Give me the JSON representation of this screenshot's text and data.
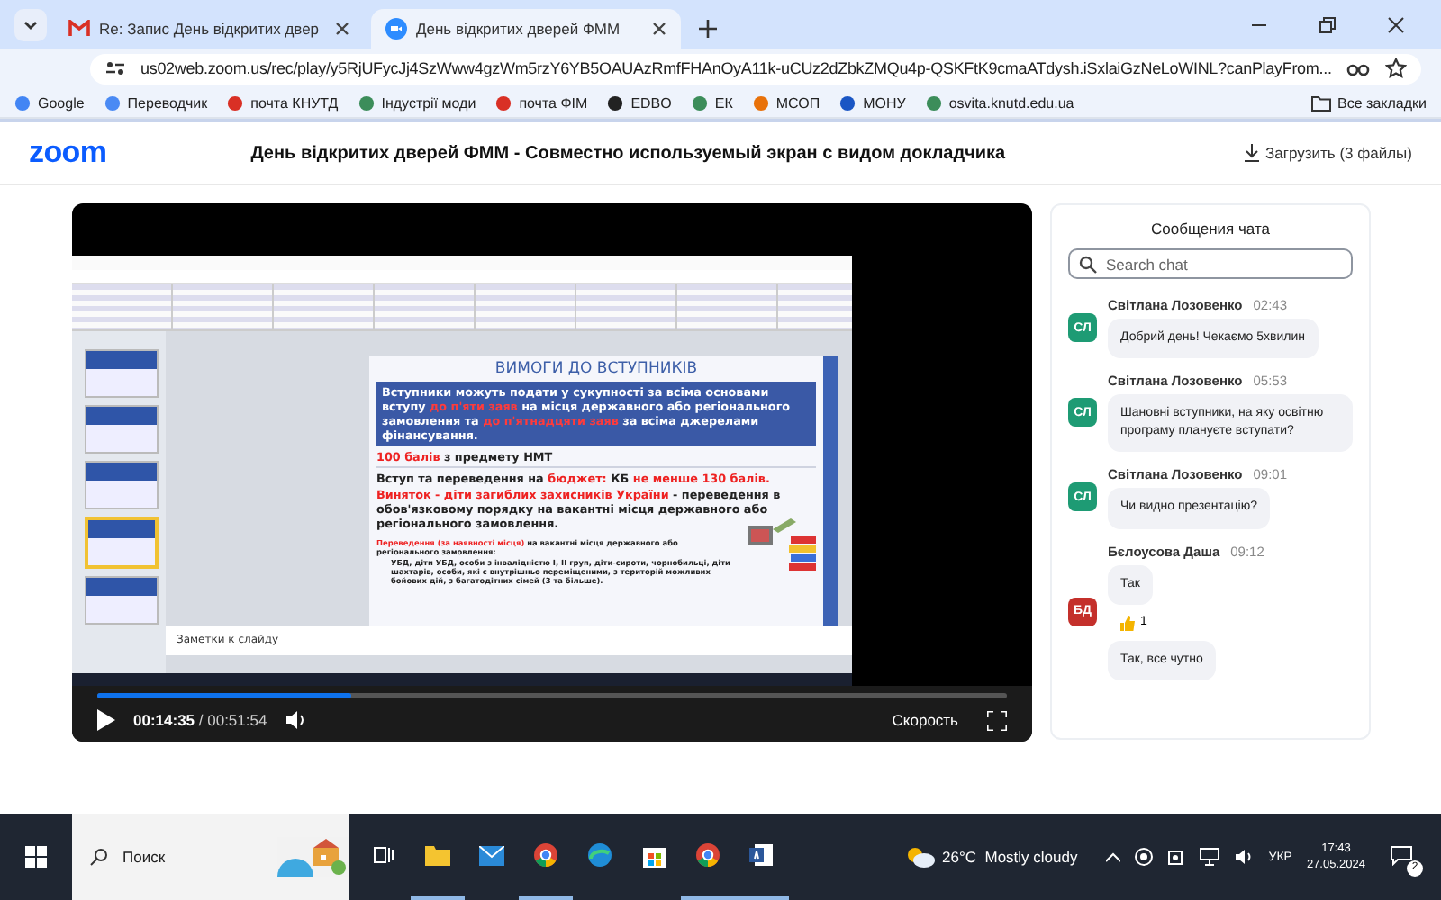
{
  "browser": {
    "tabs": [
      {
        "title": "Re: Запис День відкритих двер",
        "selected": false
      },
      {
        "title": "День відкритих дверей ФММ",
        "selected": true
      }
    ],
    "url": "us02web.zoom.us/rec/play/y5RjUFycJj4SzWww4gzWm5rzY6YB5OAUAzRmfFHAnOyA11k-uCUz2dZbkZMQu4p-QSKFtK9cmaATdysh.iSxlaiGzNeLoWINL?canPlayFrom...",
    "bookmarks": [
      {
        "label": "Google"
      },
      {
        "label": "Переводчик"
      },
      {
        "label": "почта КНУТД"
      },
      {
        "label": "Індустрії моди"
      },
      {
        "label": "почта ФІМ"
      },
      {
        "label": "EDBO"
      },
      {
        "label": "ЕК"
      },
      {
        "label": "МСОП"
      },
      {
        "label": "МОНУ"
      },
      {
        "label": "osvita.knutd.edu.ua"
      }
    ],
    "all_bookmarks": "Все закладки"
  },
  "header": {
    "logo": "zoom",
    "title": "День відкритих дверей ФММ - Совместно используемый экран с видом докладчика",
    "download": "Загрузить (3 файлы)"
  },
  "video": {
    "slide": {
      "title": "ВИМОГИ ДО ВСТУПНИКІВ",
      "lead": "Вступники можуть подати у сукупності за всіма основами вступу **до п'яти заяв** на місця державного або регіонального замовлення та **до п'ятнадцяти заяв** за всіма джерелами фінансування.",
      "score": "**100 балів** з предмету НМТ",
      "admission": "Вступ та переведення на **бюджет:** КБ **не менше 130 балів. Виняток - діти загиблих захисників України** - переведення в обов'язковому порядку на вакантні місця державного або регіонального замовлення.",
      "transfer": "**Переведення (за наявності місця)** на вакантні місця державного або регіонального замовлення:",
      "bullet": "УБД, діти УБД, особи з інвалідністю I, II груп, діти-сироти, чорнобильці, діти шахтарів, особи, які є внутрішньо переміщеними, з територій можливих бойових дій, з багатодітних сімей (3 та більше)."
    },
    "notes": "Заметки к слайду",
    "player": {
      "time": "**00:14:35** / 00:51:54",
      "level": 0.28,
      "speed": "Скорость"
    }
  },
  "chat": {
    "title": "Сообщения чата",
    "search": {
      "placeholder": "Search chat"
    },
    "messages": [
      {
        "author": "Світлана Лозовенко",
        "time": "02:43",
        "initials": "СЛ",
        "color": "#1e9b74",
        "bubbles": [
          {
            "text": "Добрий день! Чекаємо 5хвилин"
          }
        ]
      },
      {
        "author": "Світлана Лозовенко",
        "time": "05:53",
        "initials": "СЛ",
        "color": "#1e9b74",
        "bubbles": [
          {
            "text": "Шановні вступники, на яку освітню програму плануєте вступати?"
          }
        ]
      },
      {
        "author": "Світлана Лозовенко",
        "time": "09:01",
        "initials": "СЛ",
        "color": "#1e9b74",
        "bubbles": [
          {
            "text": "Чи видно презентацію?"
          }
        ]
      },
      {
        "author": "Бєлоусова Даша",
        "time": "09:12",
        "initials": "БД",
        "color": "#c4302b",
        "bubbles": [
          {
            "text": "Так",
            "reaction": "1"
          },
          {
            "text": "Так, все чутно"
          }
        ]
      }
    ]
  },
  "taskbar": {
    "search": "Поиск",
    "apps": [
      {
        "kind": "taskview",
        "active": false
      },
      {
        "kind": "folder",
        "active": true
      },
      {
        "kind": "mail",
        "active": false
      },
      {
        "kind": "chrome",
        "active": true
      },
      {
        "kind": "edge",
        "active": false
      },
      {
        "kind": "store",
        "active": false
      },
      {
        "kind": "chrome",
        "active": true
      },
      {
        "kind": "word",
        "active": true
      }
    ],
    "weather": "26°C  Mostly cloudy",
    "language": "УКР",
    "time": "17:43",
    "date": "27.05.2024",
    "notifications": "2"
  }
}
